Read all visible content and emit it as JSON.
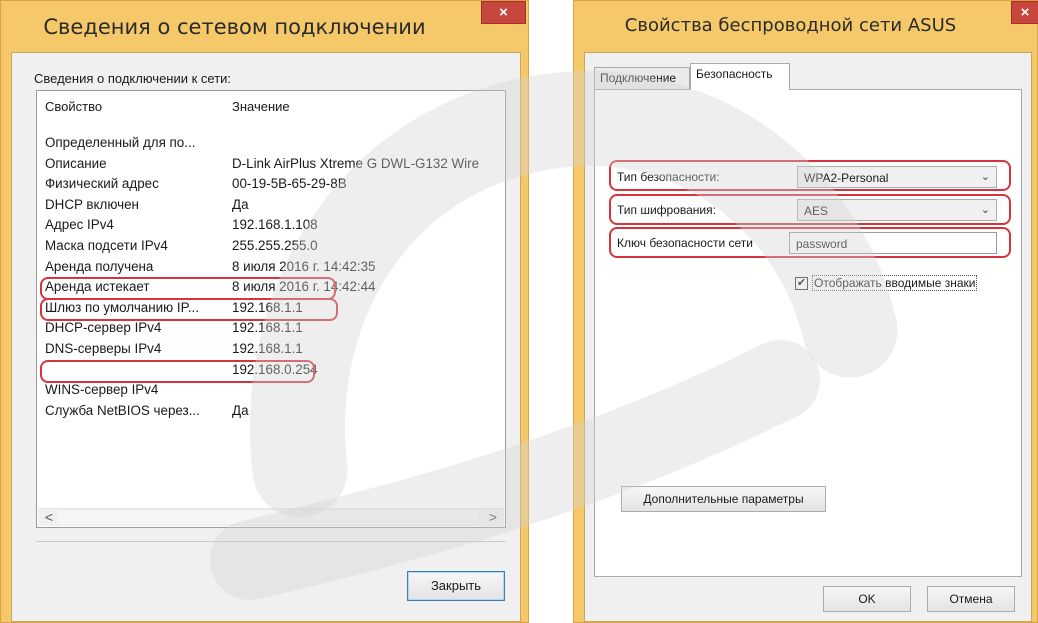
{
  "left_window": {
    "title": "Сведения о сетевом подключении",
    "close_glyph": "×",
    "subheading": "Сведения о подключении к сети:",
    "columns": [
      "Свойство",
      "Значение"
    ],
    "rows": [
      [
        "Определенный для по...",
        ""
      ],
      [
        "Описание",
        "D-Link AirPlus Xtreme G DWL-G132 Wire"
      ],
      [
        "Физический адрес",
        "00-19-5B-65-29-8B"
      ],
      [
        "DHCP включен",
        "Да"
      ],
      [
        "Адрес IPv4",
        "192.168.1.108"
      ],
      [
        "Маска подсети IPv4",
        "255.255.255.0"
      ],
      [
        "Аренда получена",
        "8 июля 2016 г. 14:42:35"
      ],
      [
        "Аренда истекает",
        "8 июля 2016 г. 14:42:44"
      ],
      [
        "Шлюз по умолчанию IP...",
        "192.168.1.1"
      ],
      [
        "DHCP-сервер IPv4",
        "192.168.1.1"
      ],
      [
        "DNS-серверы IPv4",
        "192.168.1.1"
      ],
      [
        "",
        "192.168.0.254"
      ],
      [
        "WINS-сервер IPv4",
        ""
      ],
      [
        "Служба NetBIOS через...",
        "Да"
      ]
    ],
    "scroll_left": "<",
    "scroll_right": ">",
    "close_button": "Закрыть"
  },
  "right_window": {
    "title": "Свойства беспроводной сети ASUS",
    "close_glyph": "×",
    "tabs": [
      "Подключение",
      "Безопасность"
    ],
    "active_tab": "Безопасность",
    "security_type_label": "Тип безопасности:",
    "security_type_value": "WPA2-Personal",
    "encryption_type_label": "Тип шифрования:",
    "encryption_type_value": "AES",
    "key_label": "Ключ безопасности сети",
    "key_value": "password",
    "show_chars_label": "Отображать вводимые знаки",
    "show_chars_checked": true,
    "advanced_button": "Дополнительные параметры",
    "ok_button": "OK",
    "cancel_button": "Отмена"
  },
  "icons": {
    "checkmark": "✔",
    "chevron": "⌄"
  },
  "colors": {
    "frame": "#f5c86a",
    "close": "#c7463d",
    "highlight": "#d6343c",
    "watermark": "#d3d3d3"
  }
}
